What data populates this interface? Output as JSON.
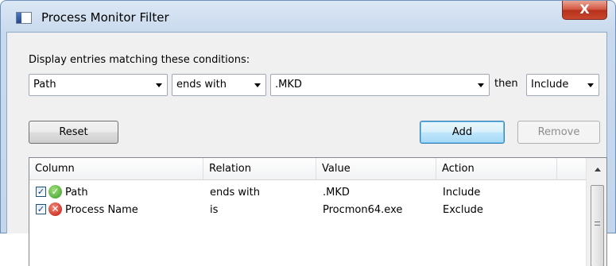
{
  "window": {
    "title": "Process Monitor Filter",
    "close_glyph": "X"
  },
  "conditions": {
    "label": "Display entries matching these conditions:",
    "column_value": "Path",
    "relation_value": "ends with",
    "value_text": ".MKD",
    "then_label": "then",
    "action_value": "Include"
  },
  "buttons": {
    "reset": "Reset",
    "add": "Add",
    "remove": "Remove"
  },
  "list": {
    "columns": [
      "Column",
      "Relation",
      "Value",
      "Action"
    ],
    "rows": [
      {
        "checked": true,
        "status": "include-icon",
        "status_glyph": "✓",
        "column": "Path",
        "relation": "ends with",
        "value": ".MKD",
        "action": "Include"
      },
      {
        "checked": true,
        "status": "exclude-icon",
        "status_glyph": "✕",
        "column": "Process Name",
        "relation": "is",
        "value": "Procmon64.exe",
        "action": "Exclude"
      }
    ]
  },
  "colors": {
    "include": "#3b9a24",
    "exclude": "#c1160a",
    "accent": "#3c7fb1"
  }
}
